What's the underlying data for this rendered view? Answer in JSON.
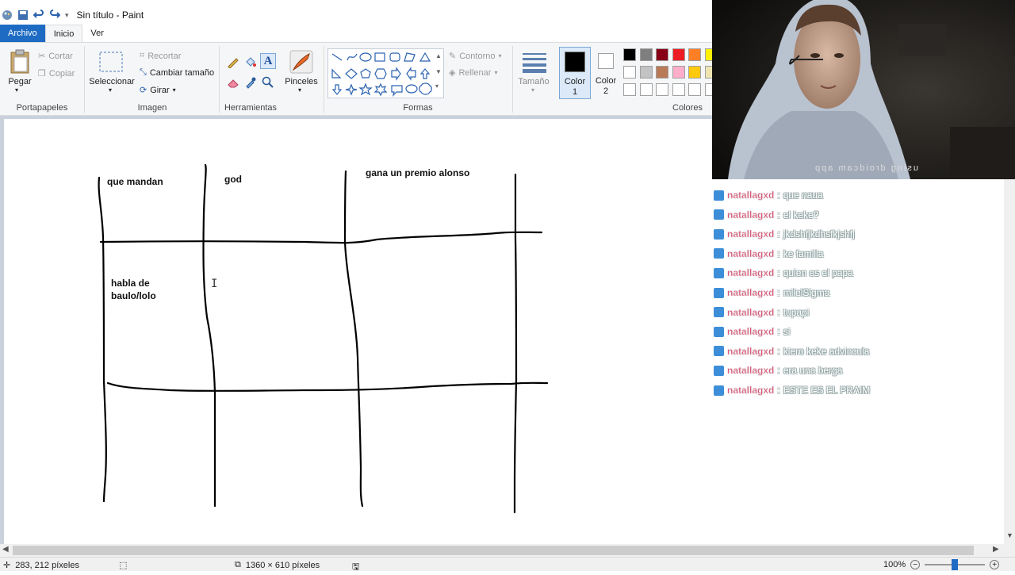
{
  "window": {
    "title": "Sin título - Paint"
  },
  "tabs": {
    "file": "Archivo",
    "home": "Inicio",
    "view": "Ver"
  },
  "clipboard": {
    "paste": "Pegar",
    "cut": "Cortar",
    "copy": "Copiar",
    "label": "Portapapeles"
  },
  "image": {
    "select": "Seleccionar",
    "crop": "Recortar",
    "resize": "Cambiar tamaño",
    "rotate": "Girar",
    "label": "Imagen"
  },
  "tools": {
    "label": "Herramientas",
    "brushes": "Pinceles"
  },
  "shapes": {
    "outline": "Contorno",
    "fill": "Rellenar",
    "label": "Formas",
    "size": "Tamaño"
  },
  "colors": {
    "color1": "Color",
    "color1_num": "1",
    "color2": "Color",
    "color2_num": "2",
    "label": "Colores",
    "palette_row1": [
      "#000000",
      "#7f7f7f",
      "#880015",
      "#ed1c24",
      "#ff7f27",
      "#fff200"
    ],
    "palette_row2": [
      "#ffffff",
      "#c3c3c3",
      "#b97a57",
      "#ffaec9",
      "#ffc90e",
      "#efe4b0"
    ],
    "palette_row3": [
      "#ffffff",
      "#ffffff",
      "#ffffff",
      "#ffffff",
      "#ffffff",
      "#ffffff"
    ],
    "active1": "#000000",
    "active2": "#ffffff"
  },
  "canvas": {
    "cell1": "que mandan",
    "cell2": "god",
    "cell3": "gana un premio alonso",
    "cell4_line1": "habla de",
    "cell4_line2": "baulo/lolo"
  },
  "webcam": {
    "overlay": "using droidcam app"
  },
  "chat": {
    "messages": [
      {
        "user": "natallagxd",
        "text": "que naua"
      },
      {
        "user": "natallagxd",
        "text": "el keke?"
      },
      {
        "user": "natallagxd",
        "text": "jkdshfjkdhsfkjshfj"
      },
      {
        "user": "natallagxd",
        "text": "ke familia"
      },
      {
        "user": "natallagxd",
        "text": "quien es el papa"
      },
      {
        "user": "natallagxd",
        "text": "milelSigma"
      },
      {
        "user": "natallagxd",
        "text": "tupapi"
      },
      {
        "user": "natallagxd",
        "text": "si"
      },
      {
        "user": "natallagxd",
        "text": "kiero keke advincula"
      },
      {
        "user": "natallagxd",
        "text": "era una berga"
      },
      {
        "user": "natallagxd",
        "text": "ESTE ES EL PRAIM"
      }
    ],
    "separator": " : "
  },
  "status": {
    "cursor": "283, 212 píxeles",
    "size": "1360 × 610 píxeles",
    "zoom": "100%"
  }
}
